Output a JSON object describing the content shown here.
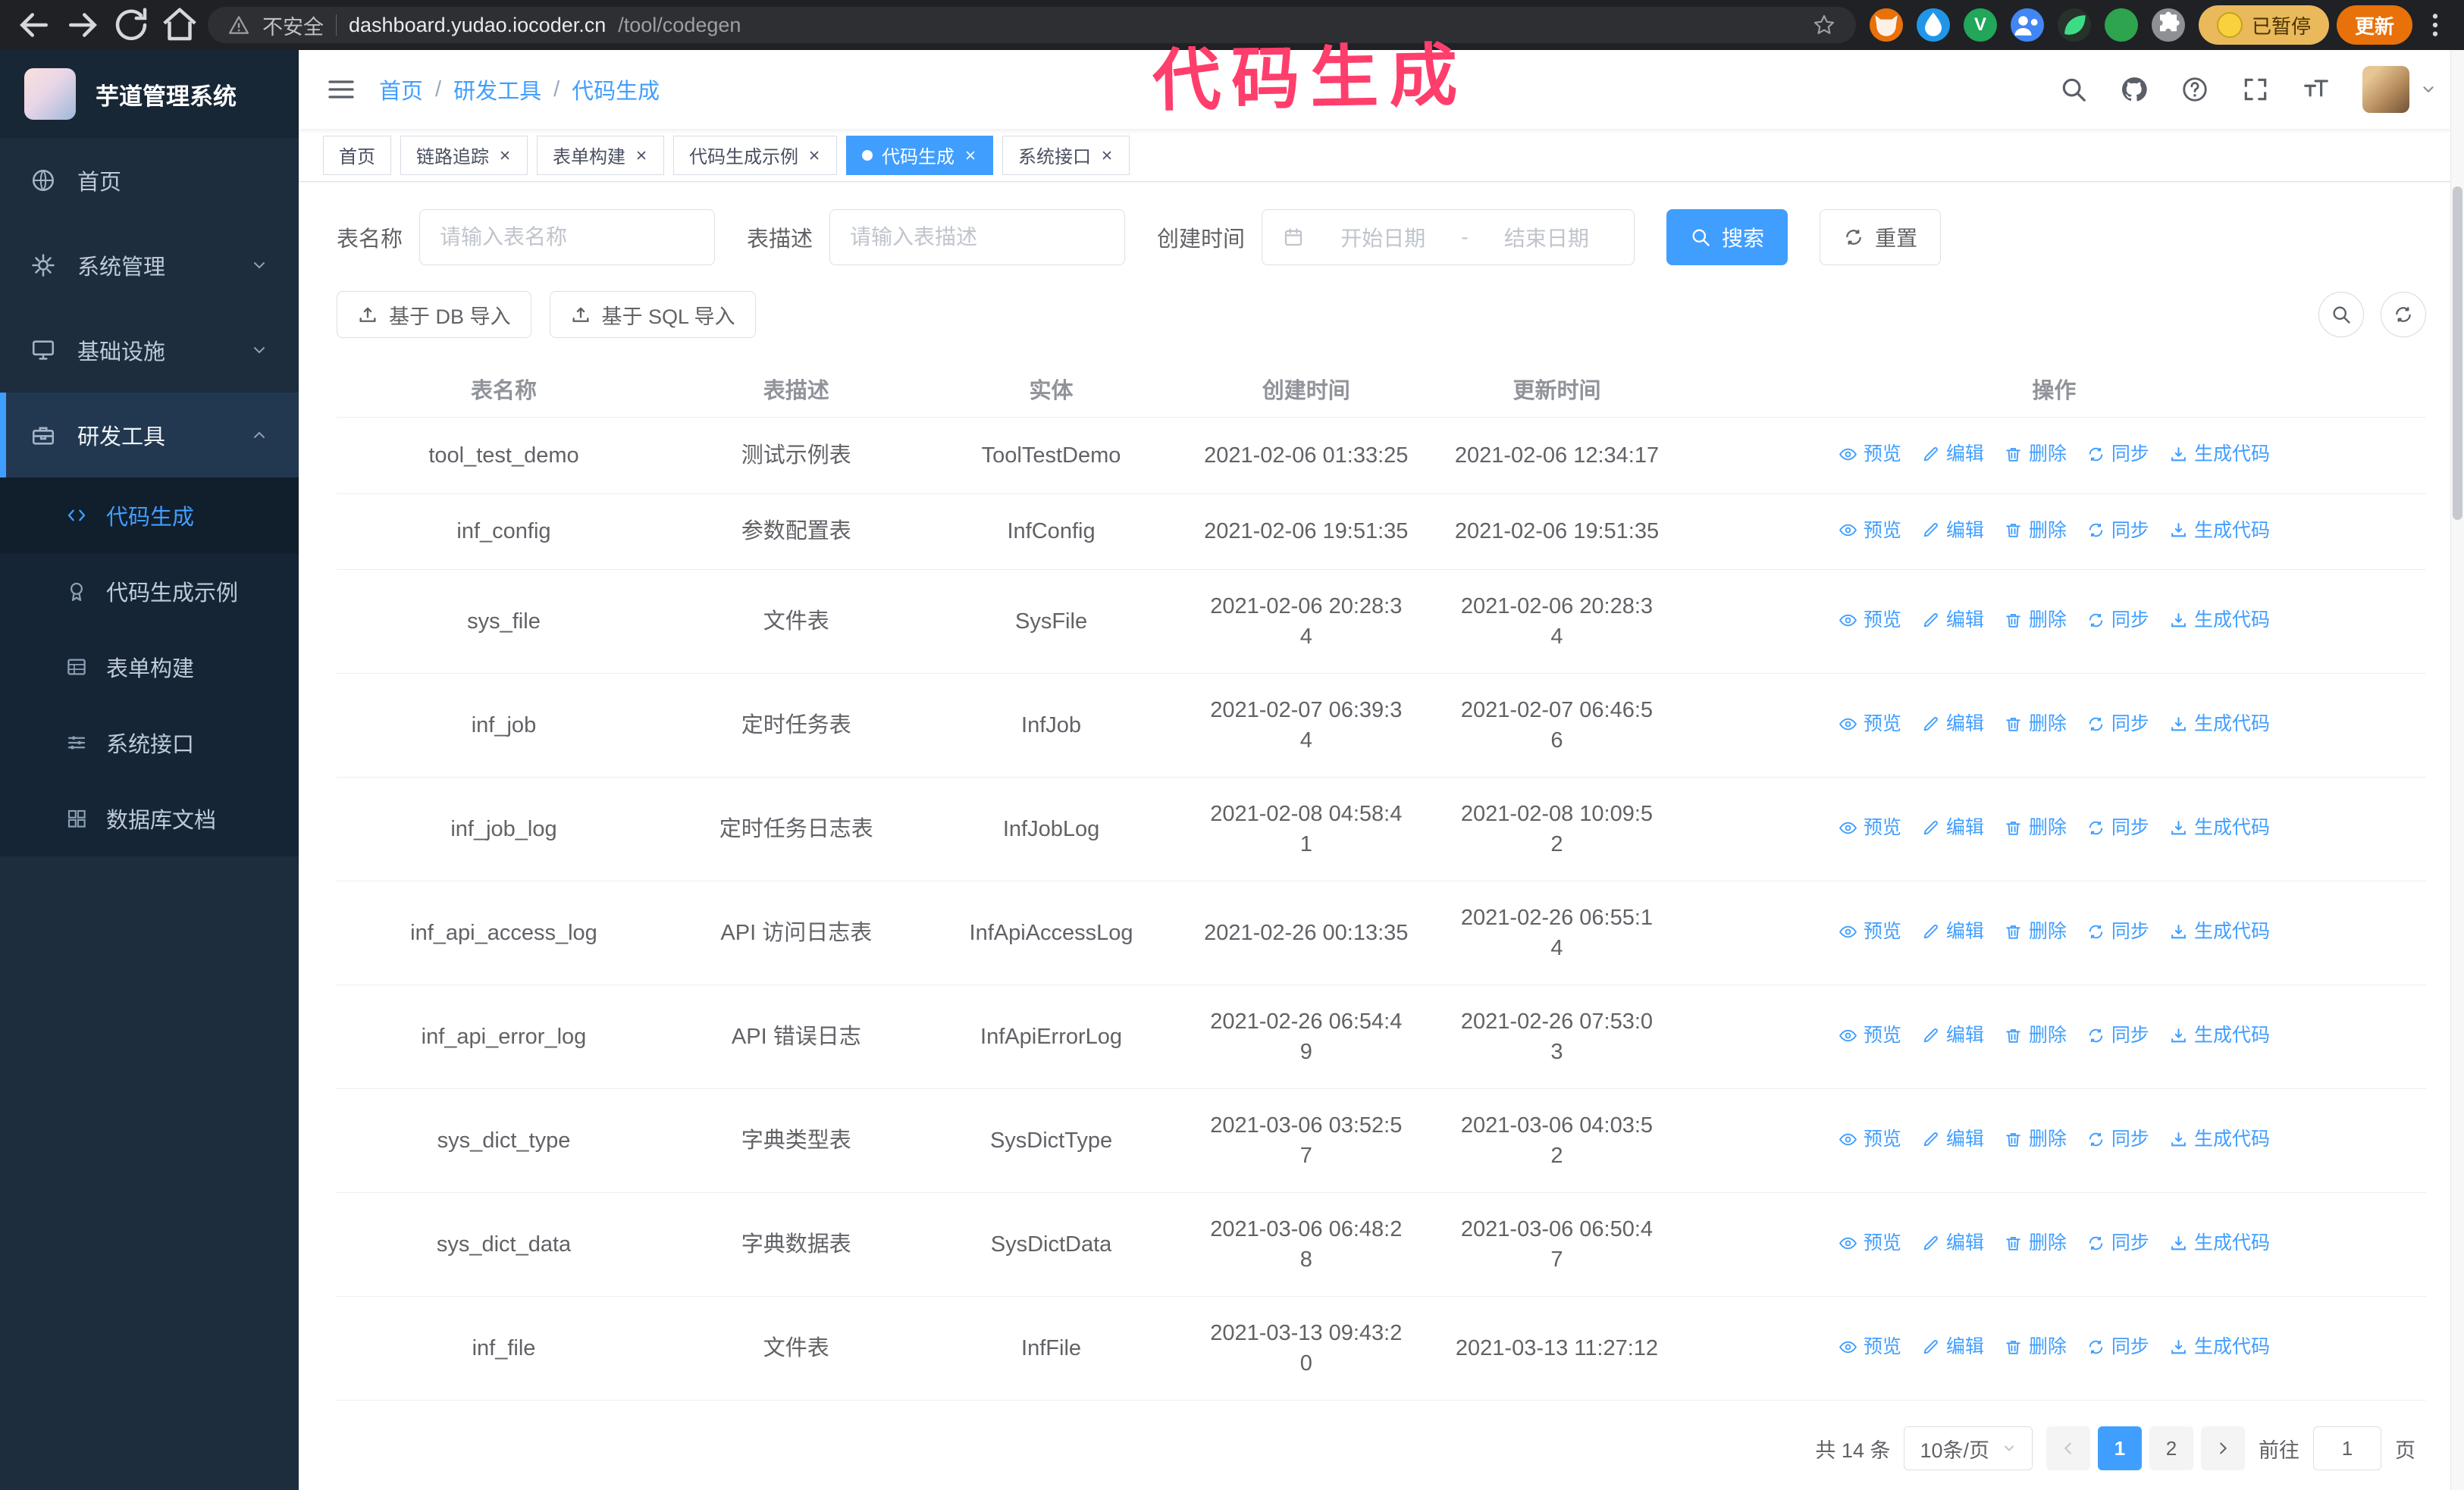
{
  "colors": {
    "primary": "#409eff",
    "annotation_pink": "#ff3e6c",
    "active_tab": "#409eff",
    "update_chip": "#e8710a"
  },
  "annotation": {
    "text": "代码生成"
  },
  "browser": {
    "security_warning": "不安全",
    "url_domain": "dashboard.yudao.iocoder.cn",
    "url_path": "/tool/codegen",
    "extensions": [
      {
        "id": "ext-orange",
        "color": "#e8710a",
        "letter": ""
      },
      {
        "id": "ext-blue-drop",
        "color": "#2196e8",
        "letter": ""
      },
      {
        "id": "ext-green-v",
        "color": "#21a65a",
        "letter": "V"
      },
      {
        "id": "ext-people",
        "color": "#4285f4",
        "letter": ""
      },
      {
        "id": "ext-dark",
        "color": "#26322a",
        "letter": ""
      },
      {
        "id": "ext-green",
        "color": "#2ea44f",
        "letter": ""
      },
      {
        "id": "ext-puzzle",
        "color": "#8d9196",
        "letter": ""
      }
    ],
    "paused_chip": "已暂停",
    "update_chip": "更新"
  },
  "sidebar": {
    "logo_title": "芋道管理系统",
    "items": [
      {
        "id": "home",
        "label": "首页",
        "icon": "globe",
        "expandable": false
      },
      {
        "id": "system-management",
        "label": "系统管理",
        "icon": "gear",
        "expandable": true
      },
      {
        "id": "infrastructure",
        "label": "基础设施",
        "icon": "monitor",
        "expandable": true
      },
      {
        "id": "dev-tools",
        "label": "研发工具",
        "icon": "toolbox",
        "expandable": true,
        "expanded": true,
        "active_parent": true,
        "children": [
          {
            "id": "codegen",
            "label": "代码生成",
            "icon": "code",
            "active": true
          },
          {
            "id": "codegen-example",
            "label": "代码生成示例",
            "icon": "badge"
          },
          {
            "id": "form-builder",
            "label": "表单构建",
            "icon": "form"
          },
          {
            "id": "system-api",
            "label": "系统接口",
            "icon": "sliders"
          },
          {
            "id": "db-doc",
            "label": "数据库文档",
            "icon": "grid"
          }
        ]
      }
    ]
  },
  "header": {
    "breadcrumb": [
      "首页",
      "研发工具",
      "代码生成"
    ]
  },
  "tabs": [
    {
      "id": "home",
      "label": "首页",
      "closable": false,
      "active": false
    },
    {
      "id": "tracing",
      "label": "链路追踪",
      "closable": true,
      "active": false
    },
    {
      "id": "form-builder",
      "label": "表单构建",
      "closable": true,
      "active": false
    },
    {
      "id": "codegen-example",
      "label": "代码生成示例",
      "closable": true,
      "active": false
    },
    {
      "id": "codegen",
      "label": "代码生成",
      "closable": true,
      "active": true
    },
    {
      "id": "system-api",
      "label": "系统接口",
      "closable": true,
      "active": false
    }
  ],
  "filters": {
    "table_name_label": "表名称",
    "table_name_placeholder": "请输入表名称",
    "table_desc_label": "表描述",
    "table_desc_placeholder": "请输入表描述",
    "create_time_label": "创建时间",
    "date_start_placeholder": "开始日期",
    "date_separator": "-",
    "date_end_placeholder": "结束日期",
    "search_button": "搜索",
    "reset_button": "重置"
  },
  "toolbar": {
    "import_db_label": "基于 DB 导入",
    "import_sql_label": "基于 SQL 导入"
  },
  "table": {
    "columns": [
      "表名称",
      "表描述",
      "实体",
      "创建时间",
      "更新时间",
      "操作"
    ],
    "actions": [
      {
        "id": "preview",
        "label": "预览",
        "icon": "eye"
      },
      {
        "id": "edit",
        "label": "编辑",
        "icon": "edit"
      },
      {
        "id": "delete",
        "label": "删除",
        "icon": "trash"
      },
      {
        "id": "sync",
        "label": "同步",
        "icon": "sync"
      },
      {
        "id": "generate-code",
        "label": "生成代码",
        "icon": "download"
      }
    ],
    "rows": [
      {
        "name": "tool_test_demo",
        "desc": "测试示例表",
        "entity": "ToolTestDemo",
        "created": "2021-02-06 01:33:25",
        "updated": "2021-02-06 12:34:17"
      },
      {
        "name": "inf_config",
        "desc": "参数配置表",
        "entity": "InfConfig",
        "created": "2021-02-06 19:51:35",
        "updated": "2021-02-06 19:51:35"
      },
      {
        "name": "sys_file",
        "desc": "文件表",
        "entity": "SysFile",
        "created": "2021-02-06 20:28:3\n4",
        "updated": "2021-02-06 20:28:3\n4"
      },
      {
        "name": "inf_job",
        "desc": "定时任务表",
        "entity": "InfJob",
        "created": "2021-02-07 06:39:3\n4",
        "updated": "2021-02-07 06:46:5\n6"
      },
      {
        "name": "inf_job_log",
        "desc": "定时任务日志表",
        "entity": "InfJobLog",
        "created": "2021-02-08 04:58:4\n1",
        "updated": "2021-02-08 10:09:5\n2"
      },
      {
        "name": "inf_api_access_log",
        "desc": "API 访问日志表",
        "entity": "InfApiAccessLog",
        "created": "2021-02-26 00:13:35",
        "updated": "2021-02-26 06:55:1\n4"
      },
      {
        "name": "inf_api_error_log",
        "desc": "API 错误日志",
        "entity": "InfApiErrorLog",
        "created": "2021-02-26 06:54:4\n9",
        "updated": "2021-02-26 07:53:0\n3"
      },
      {
        "name": "sys_dict_type",
        "desc": "字典类型表",
        "entity": "SysDictType",
        "created": "2021-03-06 03:52:5\n7",
        "updated": "2021-03-06 04:03:5\n2"
      },
      {
        "name": "sys_dict_data",
        "desc": "字典数据表",
        "entity": "SysDictData",
        "created": "2021-03-06 06:48:2\n8",
        "updated": "2021-03-06 06:50:4\n7"
      },
      {
        "name": "inf_file",
        "desc": "文件表",
        "entity": "InfFile",
        "created": "2021-03-13 09:43:2\n0",
        "updated": "2021-03-13 11:27:12"
      }
    ]
  },
  "pagination": {
    "total_label": "共 14 条",
    "page_size": "10条/页",
    "pages": [
      "1",
      "2"
    ],
    "active_page": "1",
    "goto_label": "前往",
    "goto_value": "1",
    "goto_unit": "页"
  }
}
